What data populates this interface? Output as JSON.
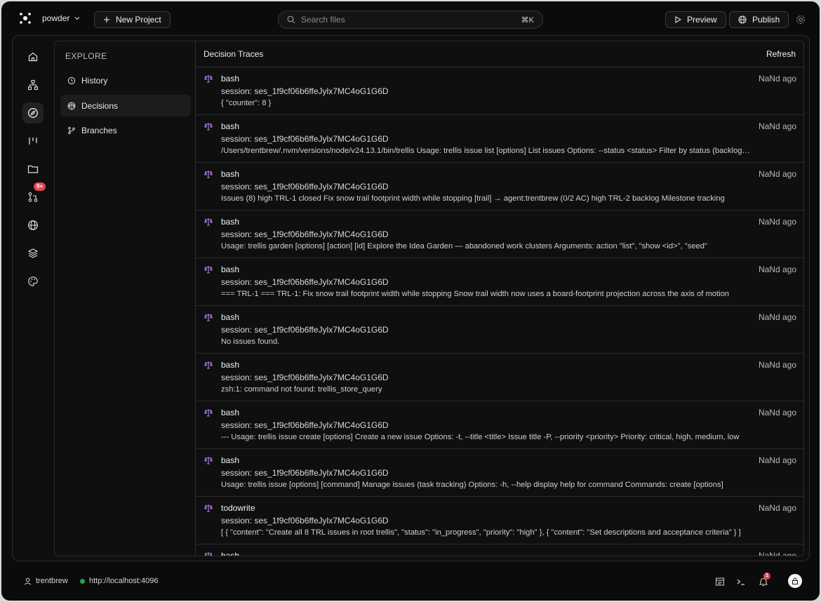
{
  "header": {
    "project_name": "powder",
    "new_project_label": "New Project",
    "search_placeholder": "Search files",
    "search_shortcut": "⌘K",
    "preview_label": "Preview",
    "publish_label": "Publish"
  },
  "rail": {
    "items": [
      "home-icon",
      "sitemap-icon",
      "compass-icon",
      "columns-icon",
      "folder-icon",
      "git-pull-request-icon",
      "globe-icon",
      "layers-icon",
      "palette-icon"
    ],
    "active": "compass-icon",
    "pr_badge": "9+"
  },
  "explore": {
    "title": "EXPLORE",
    "items": [
      {
        "label": "History",
        "icon": "history-icon"
      },
      {
        "label": "Decisions",
        "icon": "scale-icon",
        "active": true
      },
      {
        "label": "Branches",
        "icon": "git-branch-icon"
      }
    ]
  },
  "traces": {
    "title": "Decision Traces",
    "refresh_label": "Refresh",
    "rows": [
      {
        "tool": "bash",
        "session": "session: ses_1f9cf06b6ffeJylx7MC4oG1G6D",
        "output": "{ \"counter\": 8 }",
        "time": "NaNd ago"
      },
      {
        "tool": "bash",
        "session": "session: ses_1f9cf06b6ffeJylx7MC4oG1G6D",
        "output": "/Users/trentbrew/.nvm/versions/node/v24.13.1/bin/trellis Usage: trellis issue list [options] List issues Options: --status <status> Filter by status (backlog, in_progress)",
        "time": "NaNd ago"
      },
      {
        "tool": "bash",
        "session": "session: ses_1f9cf06b6ffeJylx7MC4oG1G6D",
        "output": "Issues (8) high TRL-1 closed Fix snow trail footprint width while stopping [trail] → agent:trentbrew (0/2 AC) high TRL-2 backlog Milestone tracking",
        "time": "NaNd ago"
      },
      {
        "tool": "bash",
        "session": "session: ses_1f9cf06b6ffeJylx7MC4oG1G6D",
        "output": "Usage: trellis garden [options] [action] [id] Explore the Idea Garden — abandoned work clusters Arguments: action \"list\", \"show <id>\", \"seed\"",
        "time": "NaNd ago"
      },
      {
        "tool": "bash",
        "session": "session: ses_1f9cf06b6ffeJylx7MC4oG1G6D",
        "output": "=== TRL-1 === TRL-1: Fix snow trail footprint width while stopping Snow trail width now uses a board-footprint projection across the axis of motion",
        "time": "NaNd ago"
      },
      {
        "tool": "bash",
        "session": "session: ses_1f9cf06b6ffeJylx7MC4oG1G6D",
        "output": "No issues found.",
        "time": "NaNd ago"
      },
      {
        "tool": "bash",
        "session": "session: ses_1f9cf06b6ffeJylx7MC4oG1G6D",
        "output": "zsh:1: command not found: trellis_store_query",
        "time": "NaNd ago"
      },
      {
        "tool": "bash",
        "session": "session: ses_1f9cf06b6ffeJylx7MC4oG1G6D",
        "output": "--- Usage: trellis issue create [options] Create a new issue Options: -t, --title <title> Issue title -P, --priority <priority> Priority: critical, high, medium, low",
        "time": "NaNd ago"
      },
      {
        "tool": "bash",
        "session": "session: ses_1f9cf06b6ffeJylx7MC4oG1G6D",
        "output": "Usage: trellis issue [options] [command] Manage issues (task tracking) Options: -h, --help display help for command Commands: create [options]",
        "time": "NaNd ago"
      },
      {
        "tool": "todowrite",
        "session": "session: ses_1f9cf06b6ffeJylx7MC4oG1G6D",
        "output": "[ { \"content\": \"Create all 8 TRL issues in root trellis\", \"status\": \"in_progress\", \"priority\": \"high\" }, { \"content\": \"Set descriptions and acceptance criteria\" } ]",
        "time": "NaNd ago"
      },
      {
        "tool": "bash",
        "session": "",
        "output": "",
        "time": "NaNd ago"
      }
    ]
  },
  "footer": {
    "user": "trentbrew",
    "server": "http://localhost:4096",
    "notification_count": "1"
  }
}
